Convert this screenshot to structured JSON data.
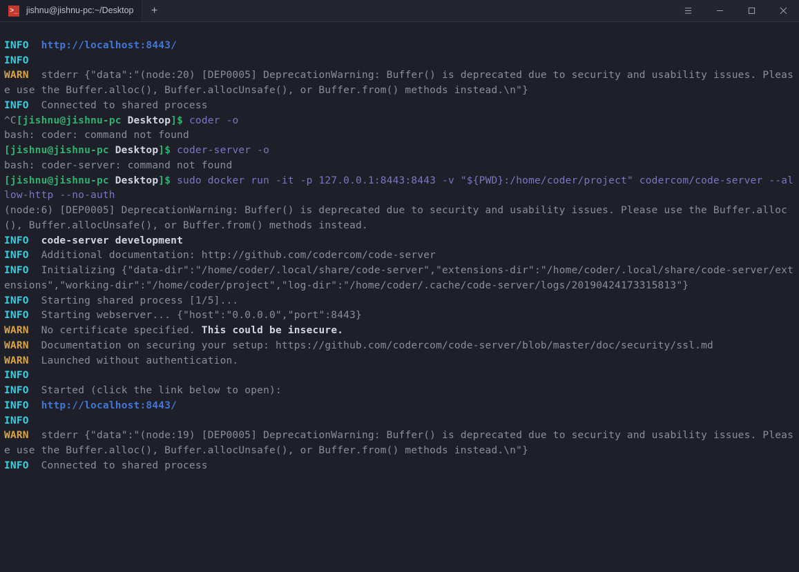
{
  "window": {
    "tab_title": "jishnu@jishnu-pc:~/Desktop",
    "new_tab": "+",
    "hamburger": "≡",
    "minimize": "—",
    "maximize": "☐",
    "close": "✕"
  },
  "labels": {
    "info": "INFO",
    "warn": "WARN"
  },
  "prompt": {
    "user": "[jishnu@jishnu-pc",
    "dir": "Desktop",
    "end": "]$"
  },
  "lines": {
    "l1_url": "http://localhost:8443/",
    "l3_warn": "stderr {\"data\":\"(node:20) [DEP0005] DeprecationWarning: Buffer() is deprecated due to security and usability issues. Please use the Buffer.alloc(), Buffer.allocUnsafe(), or Buffer.from() methods instead.\\n\"}",
    "l4_info": "Connected to shared process",
    "l5_caret": "^C",
    "l5_cmd": "coder -o",
    "l6_bash": "bash: coder: command not found",
    "l7_cmd": "coder-server -o",
    "l8_bash": "bash: coder-server: command not found",
    "l9_cmd": "sudo docker run -it -p 127.0.0.1:8443:8443 -v \"${PWD}:/home/coder/project\" codercom/code-server --allow-http --no-auth",
    "l10_dep": "(node:6) [DEP0005] DeprecationWarning: Buffer() is deprecated due to security and usability issues. Please use the Buffer.alloc(), Buffer.allocUnsafe(), or Buffer.from() methods instead.",
    "l11_bold": "code-server development",
    "l12_info": "Additional documentation: http://github.com/codercom/code-server",
    "l13_info": "Initializing {\"data-dir\":\"/home/coder/.local/share/code-server\",\"extensions-dir\":\"/home/coder/.local/share/code-server/extensions\",\"working-dir\":\"/home/coder/project\",\"log-dir\":\"/home/coder/.cache/code-server/logs/20190424173315813\"}",
    "l14_info": "Starting shared process [1/5]...",
    "l15_info": "Starting webserver... {\"host\":\"0.0.0.0\",\"port\":8443}",
    "l16_a": "No certificate specified. ",
    "l16_b": "This could be insecure.",
    "l17_warn": "Documentation on securing your setup: https://github.com/codercom/code-server/blob/master/doc/security/ssl.md",
    "l18_warn": "Launched without authentication.",
    "l20_info": "Started (click the link below to open):",
    "l21_url": "http://localhost:8443/",
    "l23_warn": "stderr {\"data\":\"(node:19) [DEP0005] DeprecationWarning: Buffer() is deprecated due to security and usability issues. Please use the Buffer.alloc(), Buffer.allocUnsafe(), or Buffer.from() methods instead.\\n\"}",
    "l24_info": "Connected to shared process"
  }
}
